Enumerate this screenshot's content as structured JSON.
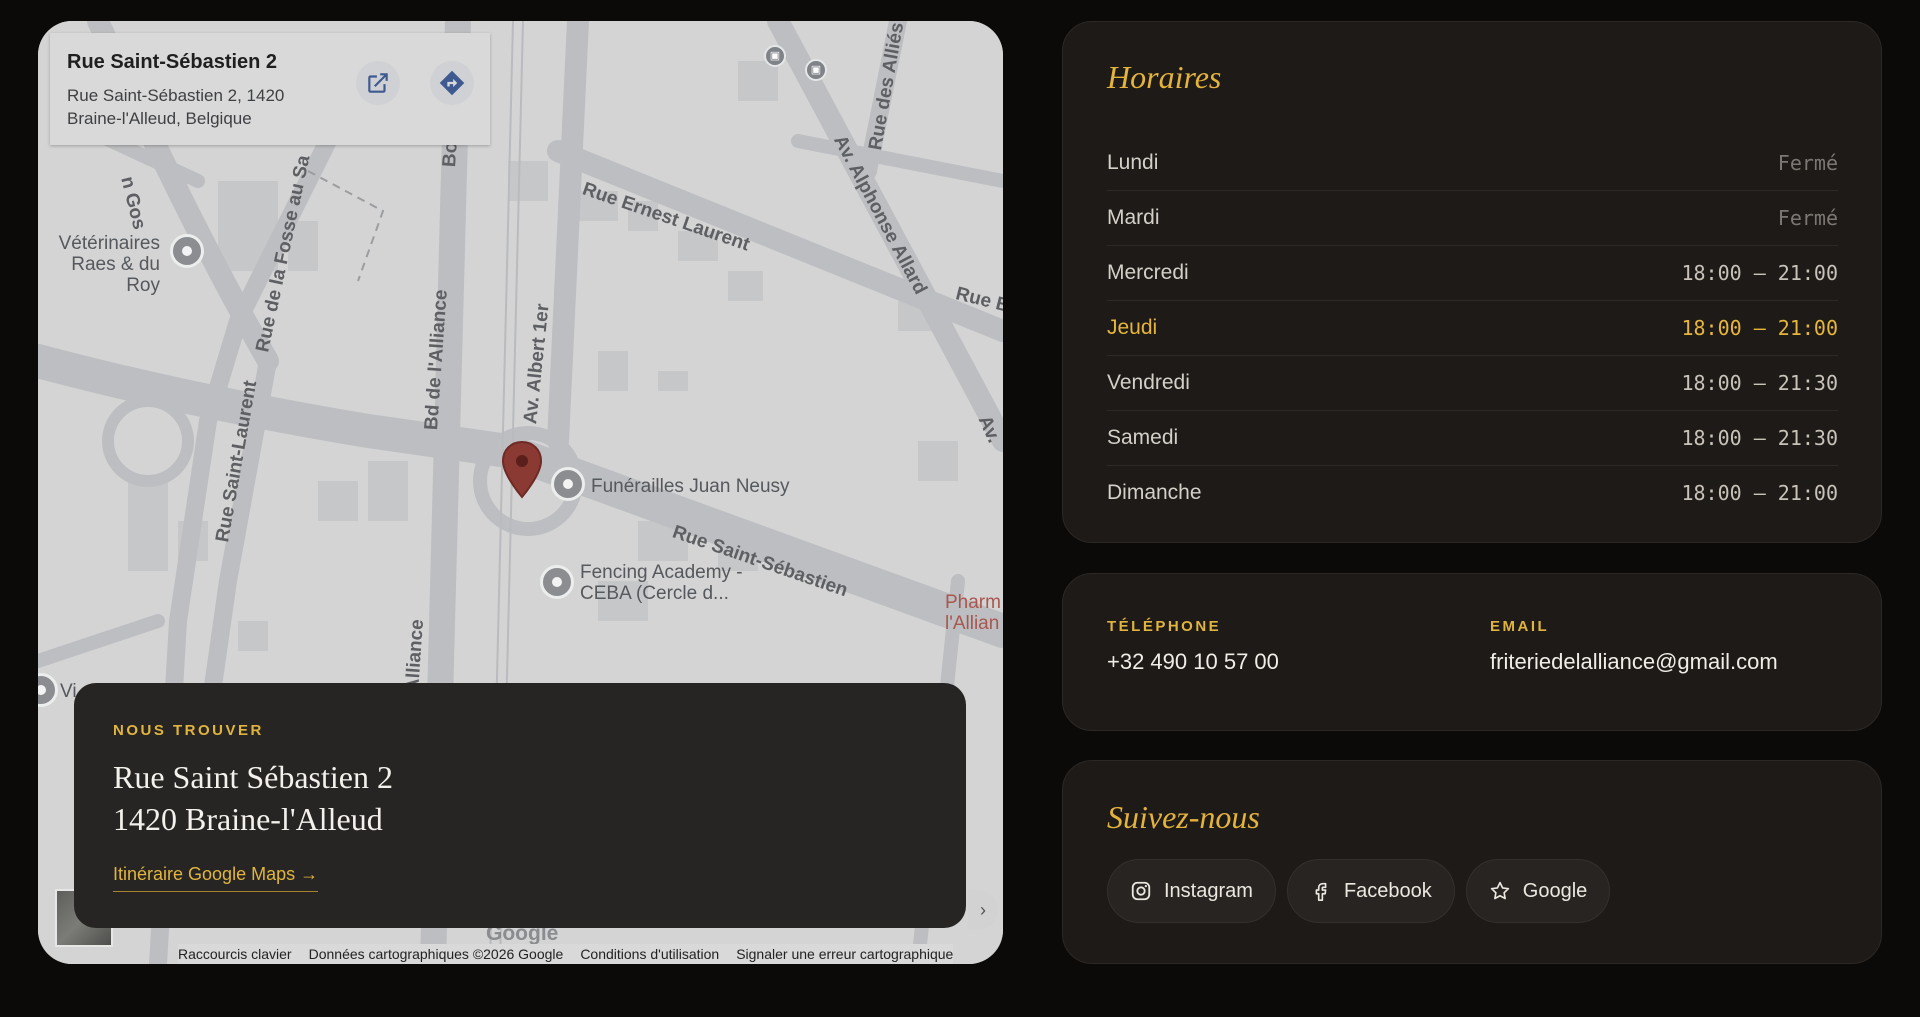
{
  "map": {
    "info_card": {
      "title": "Rue Saint-Sébastien 2",
      "address": "Rue Saint-Sébastien 2, 1420 Braine-l'Alleud, Belgique",
      "open_icon": "open-in-new-icon",
      "directions_icon": "directions-icon"
    },
    "street_labels": {
      "ernest_laurent": "Rue Ernest Laurent",
      "alphonse_allard": "Av. Alphonse Allard",
      "des_allies": "Rue des Alliés",
      "fosse_au_sable": "Rue de la Fosse au Sa",
      "alliance": "Bd de l'Alliance",
      "albert": "Av. Albert 1er",
      "saint_laurent": "Rue Saint-Laurent",
      "saint_sebastien": "Rue Saint-Sébastien",
      "gos": "n Gos",
      "rue_b": "Rue B",
      "av_right": "Av.",
      "alliance_lower": "Alliance",
      "bd_top": "Bo"
    },
    "pois": {
      "veterinaires": "Vétérinaires\nRaes & du Roy",
      "funerailles": "Funérailles Juan Neusy",
      "fencing": "Fencing Academy -\nCEBA (Cercle d...",
      "pharmacie": "Pharm\nl'Allian",
      "vi": "Vi"
    },
    "footer": {
      "shortcuts": "Raccourcis clavier",
      "map_data": "Données cartographiques ©2026 Google",
      "terms": "Conditions d'utilisation",
      "report": "Signaler une erreur cartographique"
    },
    "google_logo": "Google",
    "overlay": {
      "kicker": "NOUS TROUVER",
      "address_line1": "Rue Saint Sébastien 2",
      "address_line2": "1420 Braine-l'Alleud",
      "link": "Itinéraire Google Maps →"
    }
  },
  "hours": {
    "title": "Horaires",
    "rows": [
      {
        "day": "Lundi",
        "time": "Fermé",
        "closed": true
      },
      {
        "day": "Mardi",
        "time": "Fermé",
        "closed": true
      },
      {
        "day": "Mercredi",
        "time": "18:00 — 21:00"
      },
      {
        "day": "Jeudi",
        "time": "18:00 — 21:00",
        "today": true
      },
      {
        "day": "Vendredi",
        "time": "18:00 — 21:30"
      },
      {
        "day": "Samedi",
        "time": "18:00 — 21:30"
      },
      {
        "day": "Dimanche",
        "time": "18:00 — 21:00"
      }
    ]
  },
  "contact": {
    "phone_label": "TÉLÉPHONE",
    "phone_value": "+32 490 10 57 00",
    "email_label": "EMAIL",
    "email_value": "friteriedelalliance@gmail.com"
  },
  "social": {
    "title": "Suivez-nous",
    "buttons": [
      {
        "label": "Instagram",
        "icon": "instagram-icon"
      },
      {
        "label": "Facebook",
        "icon": "facebook-icon"
      },
      {
        "label": "Google",
        "icon": "star-icon"
      }
    ]
  },
  "colors": {
    "accent": "#e4b33c",
    "background": "#0b0a09",
    "card": "#1d1a18"
  }
}
